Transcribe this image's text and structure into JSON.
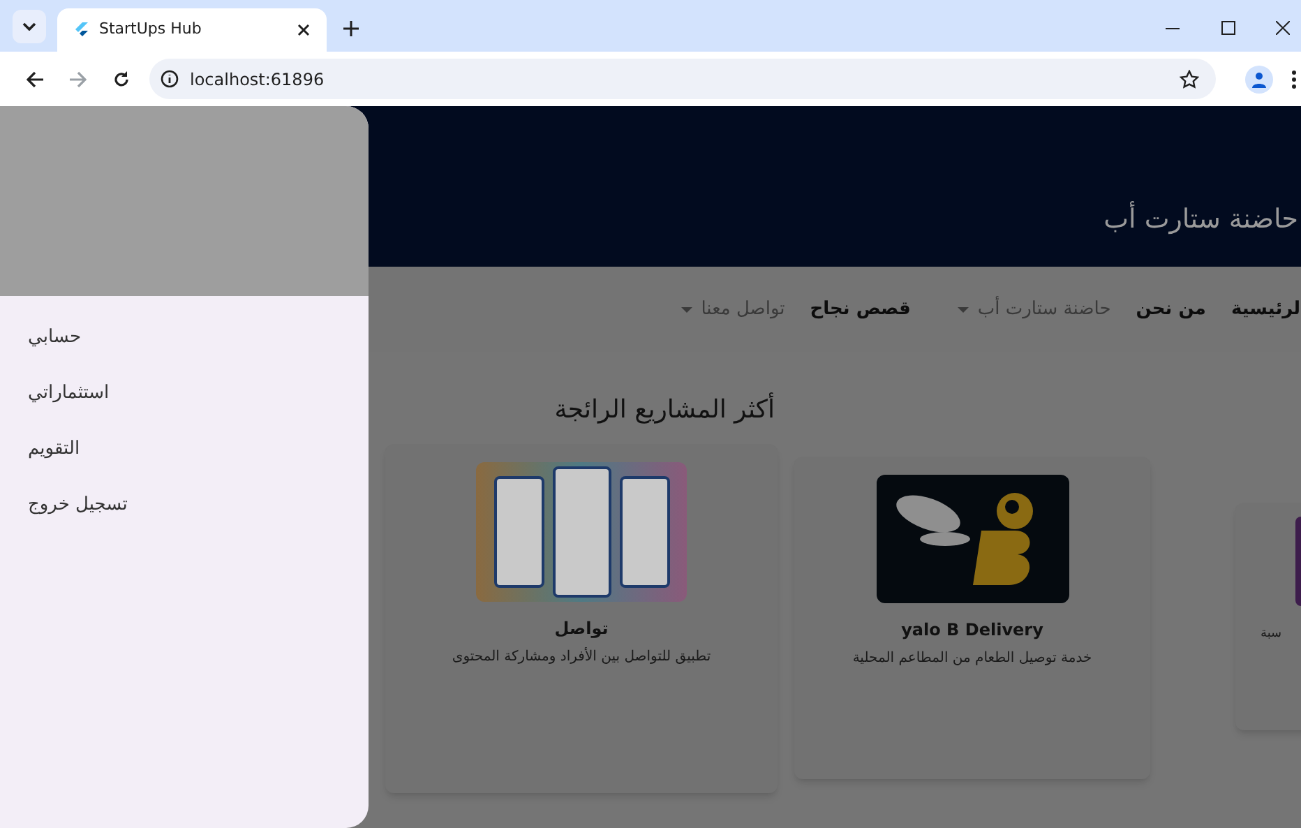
{
  "browser": {
    "tab_title": "StartUps Hub",
    "url": "localhost:61896"
  },
  "header": {
    "title": "حاضنة ستارت أب"
  },
  "nav": [
    {
      "label": "الرئيسية",
      "dropdown": false,
      "disabled": false
    },
    {
      "label": "من نحن",
      "dropdown": false,
      "disabled": false
    },
    {
      "label": "حاضنة ستارت أب",
      "dropdown": true,
      "disabled": true
    },
    {
      "label": "قصص نجاح",
      "dropdown": false,
      "disabled": false
    },
    {
      "label": "تواصل معنا",
      "dropdown": true,
      "disabled": true
    }
  ],
  "section_title": "أكثر المشاريع الرائجة",
  "projects": [
    {
      "kind": "purple",
      "description": "سبة"
    },
    {
      "kind": "bee",
      "title": "yalo B Delivery",
      "description": "خدمة توصيل الطعام من المطاعم المحلية"
    },
    {
      "kind": "phones",
      "title": "تواصل",
      "description": "تطبيق للتواصل بين الأفراد ومشاركة المحتوى"
    }
  ],
  "drawer": {
    "items": [
      "حسابي",
      "استثماراتي",
      "التقويم",
      "تسجيل خروج"
    ]
  }
}
